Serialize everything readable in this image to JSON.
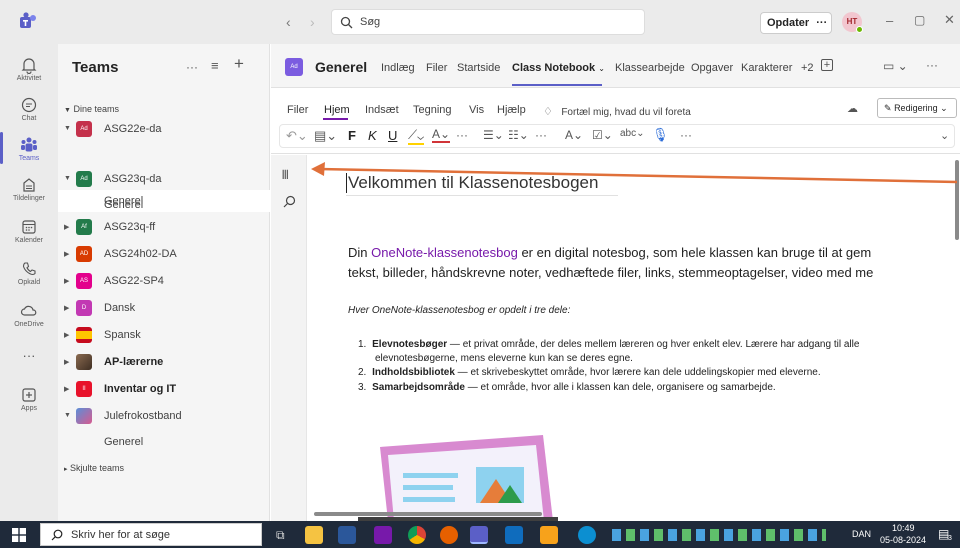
{
  "titlebar": {
    "search_placeholder": "Søg",
    "update_label": "Opdater",
    "more_label": "···",
    "user_initials": "HT",
    "minimize": "–",
    "restore": "▢",
    "close": "✕"
  },
  "rail": {
    "items": [
      {
        "label": "Aktivitet",
        "icon": "bell-icon"
      },
      {
        "label": "Chat",
        "icon": "chat-icon"
      },
      {
        "label": "Teams",
        "icon": "teams-icon",
        "active": true
      },
      {
        "label": "Tildelinger",
        "icon": "assignments-icon"
      },
      {
        "label": "Kalender",
        "icon": "calendar-icon"
      },
      {
        "label": "Opkald",
        "icon": "phone-icon"
      },
      {
        "label": "OneDrive",
        "icon": "cloud-icon"
      },
      {
        "label": "···",
        "icon": "more-icon"
      },
      {
        "label": "Apps",
        "icon": "apps-icon"
      }
    ]
  },
  "teams_pane": {
    "title": "Teams",
    "more": "···",
    "filter": "≡",
    "add": "+",
    "section_label": "Dine teams",
    "teams": [
      {
        "avatar": "Ad",
        "name": "ASG22e-da",
        "color": "#c4314b"
      },
      {
        "channel": "Generel"
      },
      {
        "avatar": "Ad",
        "name": "ASG23q-da",
        "color": "#237b4b"
      },
      {
        "channel": "Generel"
      },
      {
        "avatar": "Af",
        "name": "ASG23q-ff",
        "color": "#237b4b"
      },
      {
        "avatar": "AD",
        "name": "ASG24h02-DA",
        "color": "#d83b01"
      },
      {
        "avatar": "AS",
        "name": "ASG22-SP4",
        "color": "#e3008c"
      },
      {
        "avatar": "D",
        "name": "Dansk",
        "color": "#c239b3"
      },
      {
        "avatar": "",
        "name": "Spansk",
        "color": "#c60b1e"
      },
      {
        "avatar": "",
        "name": "AP-lærerne",
        "color": "#6b4f3a"
      },
      {
        "avatar": "II",
        "name": "Inventar og IT",
        "color": "#e8122b"
      },
      {
        "avatar": "",
        "name": "Julefrokostband",
        "color": "#3b6bb0"
      },
      {
        "channel": "Generel"
      }
    ],
    "hidden_teams": "Skjulte teams"
  },
  "channel_header": {
    "avatar": "Ad",
    "name": "Generel",
    "tabs": [
      "Indlæg",
      "Filer",
      "Startside",
      "Class Notebook",
      "Klassearbejde",
      "Opgaver",
      "Karakterer",
      "+2"
    ],
    "active_tab": "Class Notebook"
  },
  "ribbon": {
    "tabs": [
      "Filer",
      "Hjem",
      "Indsæt",
      "Tegning",
      "Vis",
      "Hjælp"
    ],
    "active_tab": "Hjem",
    "tell_me": "Fortæl mig, hvad du vil foreta",
    "editing": "Redigering",
    "bold": "F",
    "italic": "K",
    "underline": "U"
  },
  "page": {
    "title": "Velkommen til Klassenotesbogen",
    "intro_link": "OneNote-klassenotesbog",
    "intro_pre": "Din ",
    "intro_post": " er en digital notesbog, som hele klassen kan bruge til at gem",
    "intro_line2": "tekst, billeder, håndskrevne noter, vedhæftede filer, links, stemmeoptagelser, video med me",
    "subtitle": "Hver OneNote-klassenotesbog er opdelt i tre dele:",
    "items": [
      {
        "num": "1.",
        "bold": "Elevnotesbøger",
        "text": " — et privat område, der deles mellem læreren og hver enkelt elev. Lærere har adgang til alle",
        "text2": "elevnotesbøgerne, mens eleverne kun kan se deres egne."
      },
      {
        "num": "2.",
        "bold": "Indholdsbibliotek",
        "text": " — et skrivebeskyttet område, hvor lærere kan dele uddelingskopier med eleverne."
      },
      {
        "num": "3.",
        "bold": "Samarbejdsområde",
        "text": " — et område, hvor alle i klassen kan dele, organisere og samarbejde."
      }
    ]
  },
  "taskbar": {
    "search_placeholder": "Skriv her for at søge",
    "language": "DAN",
    "time": "10:49",
    "date": "05-08-2024",
    "notifications": "3"
  },
  "colors": {
    "accent": "#5b5fc7",
    "arrow": "#e0703a",
    "link": "#7719aa"
  }
}
